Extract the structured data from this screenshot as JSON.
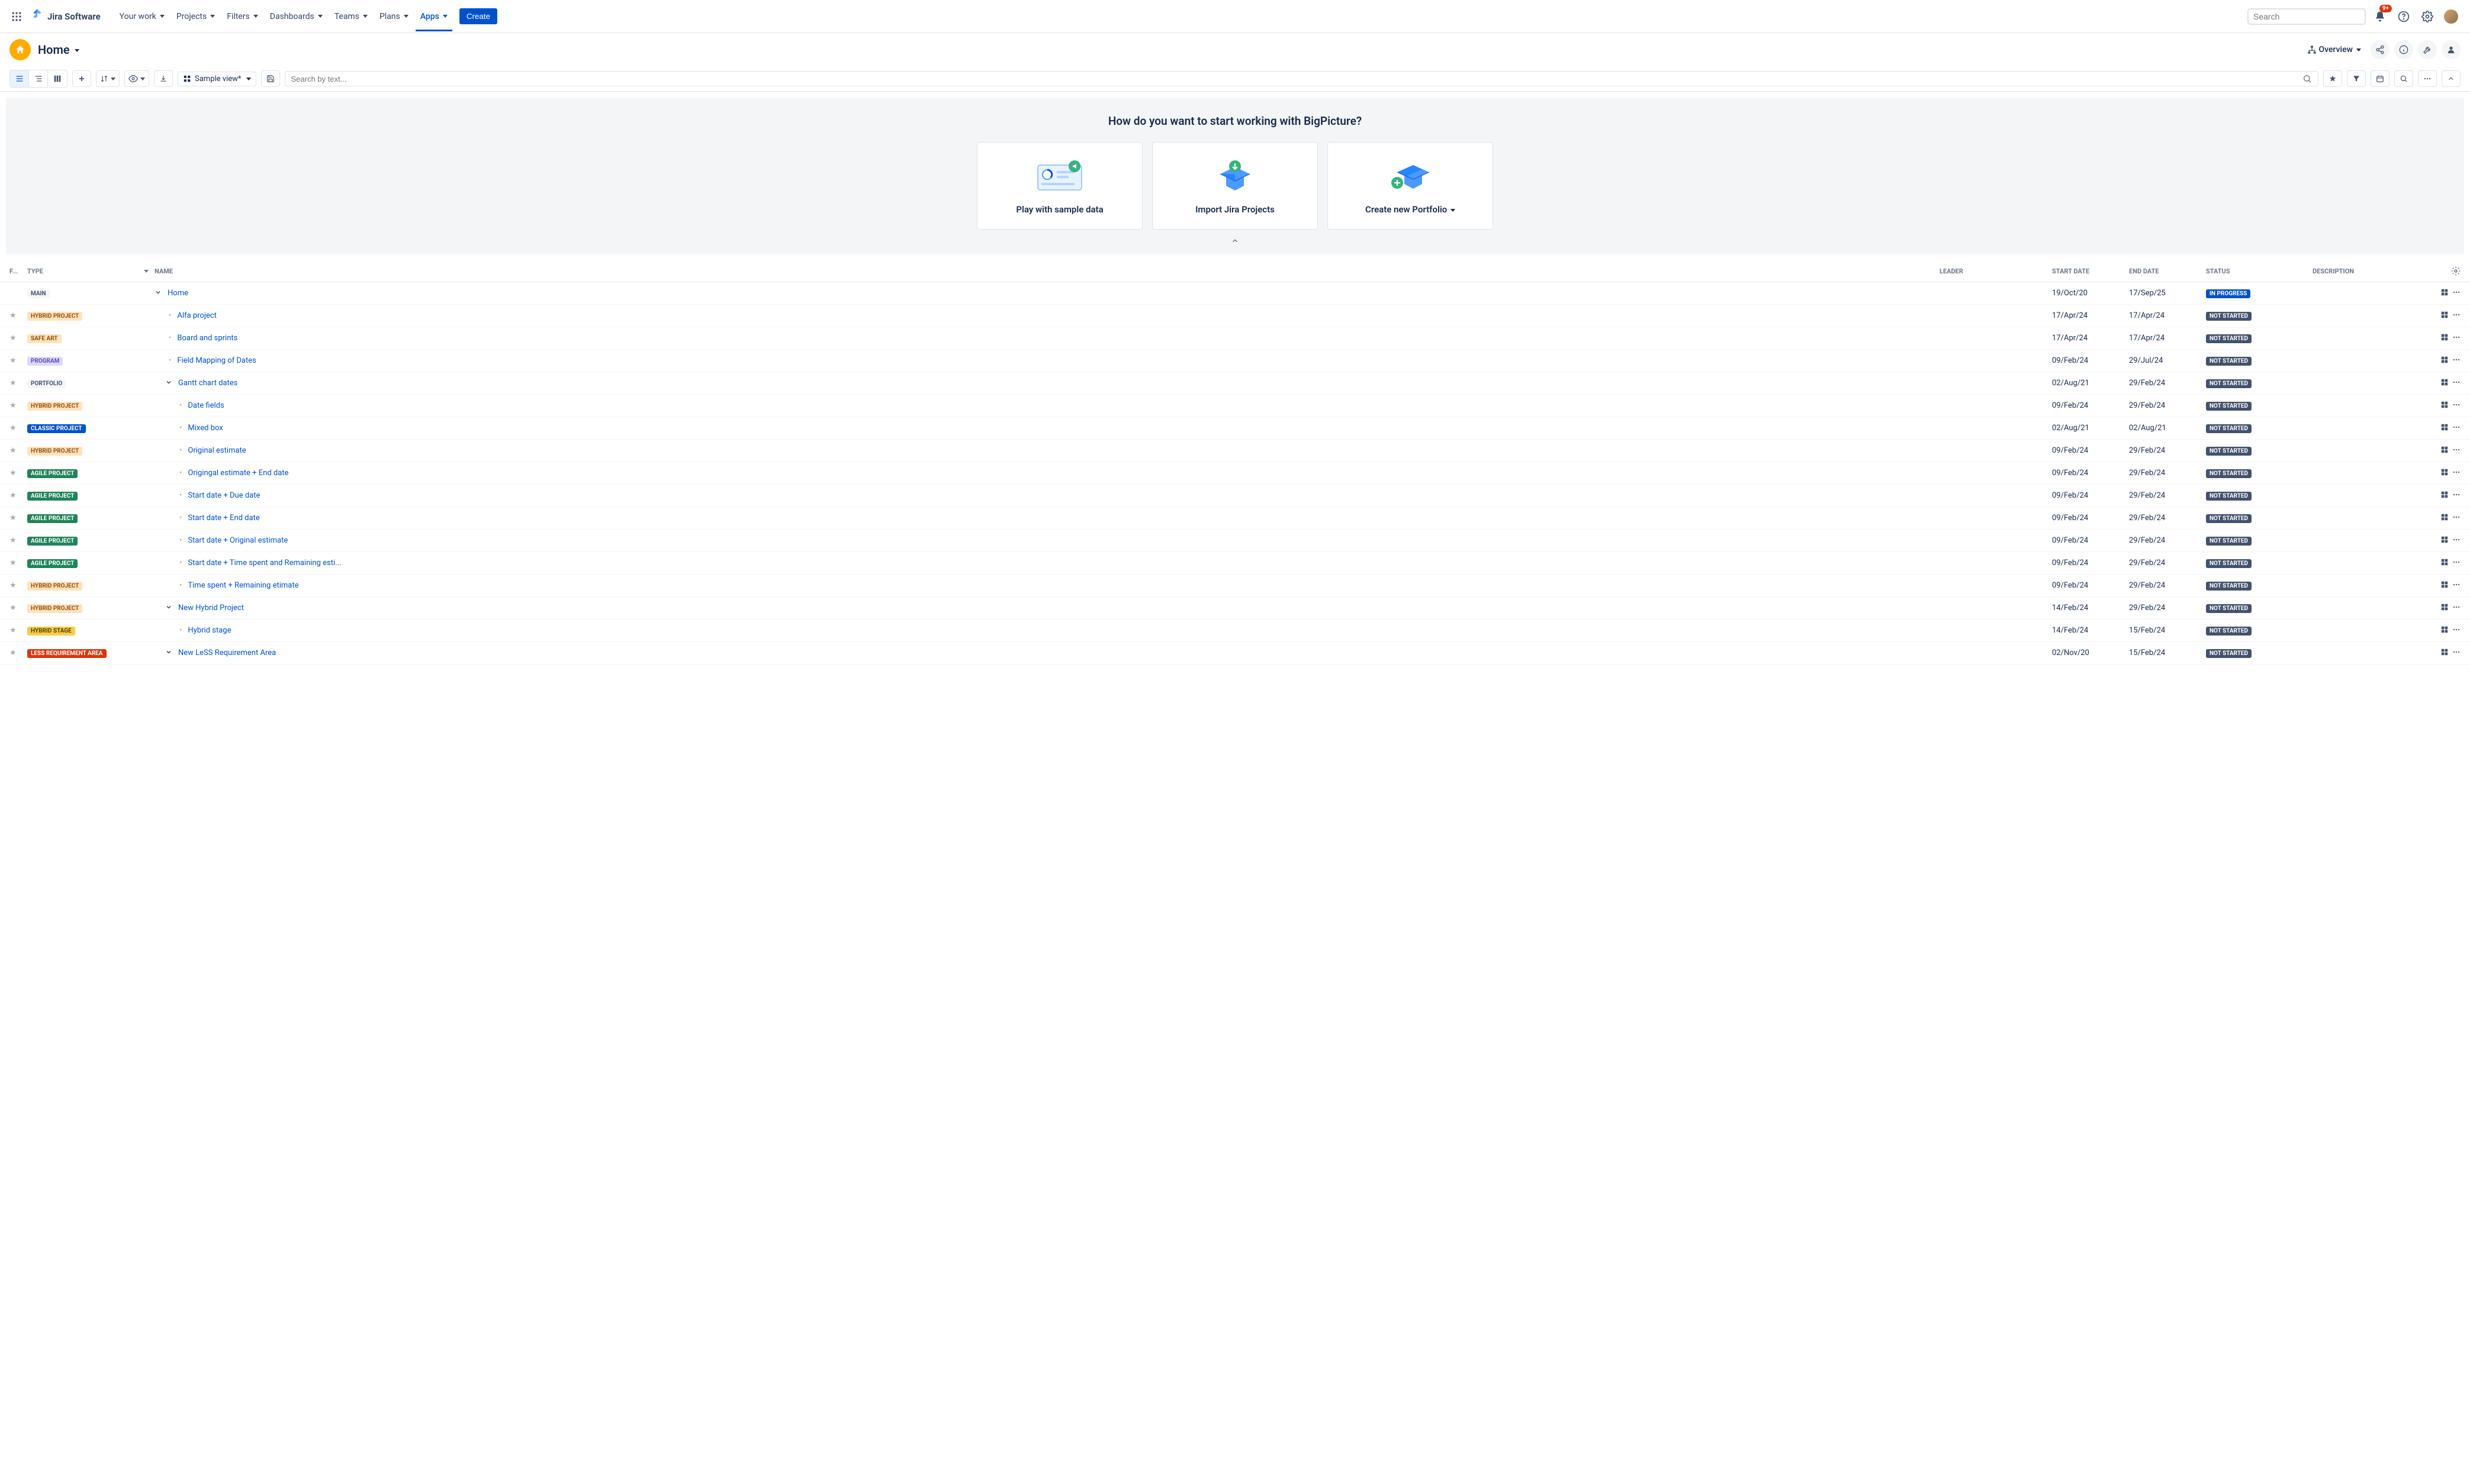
{
  "topnav": {
    "logo_text": "Jira Software",
    "items": [
      "Your work",
      "Projects",
      "Filters",
      "Dashboards",
      "Teams",
      "Plans",
      "Apps"
    ],
    "active_index": 6,
    "create_label": "Create",
    "search_placeholder": "Search",
    "notif_count": "9+"
  },
  "breadcrumb": {
    "title": "Home",
    "overview_label": "Overview"
  },
  "toolbar": {
    "view_label": "Sample view",
    "view_dirty": "*",
    "filter_placeholder": "Search by text..."
  },
  "banner": {
    "heading": "How do you want to start working with BigPicture?",
    "cards": [
      {
        "title": "Play with sample data"
      },
      {
        "title": "Import Jira Projects"
      },
      {
        "title": "Create new Portfolio"
      }
    ]
  },
  "table": {
    "headers": {
      "fav": "F...",
      "type": "TYPE",
      "name": "NAME",
      "leader": "LEADER",
      "start": "START DATE",
      "end": "END DATE",
      "status": "STATUS",
      "desc": "DESCRIPTION"
    },
    "type_colors": {
      "MAIN": {
        "bg": "#F4F5F7",
        "fg": "#42526E"
      },
      "HYBRID PROJECT": {
        "bg": "#FFE2BD",
        "fg": "#974F0C"
      },
      "SAFE ART": {
        "bg": "#FFE2BD",
        "fg": "#974F0C"
      },
      "PROGRAM": {
        "bg": "#DFD8FD",
        "fg": "#5E4DB2"
      },
      "PORTFOLIO": {
        "bg": "#F4F5F7",
        "fg": "#42526E"
      },
      "CLASSIC PROJECT": {
        "bg": "#0052CC",
        "fg": "#FFFFFF"
      },
      "AGILE PROJECT": {
        "bg": "#1F845A",
        "fg": "#FFFFFF"
      },
      "HYBRID STAGE": {
        "bg": "#F5CD47",
        "fg": "#533F04"
      },
      "LESS REQUIREMENT AREA": {
        "bg": "#DE350B",
        "fg": "#FFFFFF"
      }
    },
    "status_colors": {
      "IN PROGRESS": "#0052CC",
      "NOT STARTED": "#42526E"
    },
    "rows": [
      {
        "fav": false,
        "type": "MAIN",
        "indent": 0,
        "expand": "open",
        "name": "Home",
        "start": "19/Oct/20",
        "end": "17/Sep/25",
        "status": "IN PROGRESS"
      },
      {
        "fav": true,
        "type": "HYBRID PROJECT",
        "indent": 1,
        "expand": "leaf",
        "name": "Alfa project",
        "start": "17/Apr/24",
        "end": "17/Apr/24",
        "status": "NOT STARTED"
      },
      {
        "fav": true,
        "type": "SAFE ART",
        "indent": 1,
        "expand": "leaf",
        "name": "Board and sprints",
        "start": "17/Apr/24",
        "end": "17/Apr/24",
        "status": "NOT STARTED"
      },
      {
        "fav": true,
        "type": "PROGRAM",
        "indent": 1,
        "expand": "leaf",
        "name": "Field Mapping of Dates",
        "start": "09/Feb/24",
        "end": "29/Jul/24",
        "status": "NOT STARTED"
      },
      {
        "fav": true,
        "type": "PORTFOLIO",
        "indent": 1,
        "expand": "open",
        "name": "Gantt chart dates",
        "start": "02/Aug/21",
        "end": "29/Feb/24",
        "status": "NOT STARTED"
      },
      {
        "fav": true,
        "type": "HYBRID PROJECT",
        "indent": 2,
        "expand": "leaf",
        "name": "Date fields",
        "start": "09/Feb/24",
        "end": "29/Feb/24",
        "status": "NOT STARTED"
      },
      {
        "fav": true,
        "type": "CLASSIC PROJECT",
        "indent": 2,
        "expand": "leaf",
        "name": "Mixed box",
        "start": "02/Aug/21",
        "end": "02/Aug/21",
        "status": "NOT STARTED"
      },
      {
        "fav": true,
        "type": "HYBRID PROJECT",
        "indent": 2,
        "expand": "leaf",
        "name": "Original estimate",
        "start": "09/Feb/24",
        "end": "29/Feb/24",
        "status": "NOT STARTED"
      },
      {
        "fav": true,
        "type": "AGILE PROJECT",
        "indent": 2,
        "expand": "leaf",
        "name": "Origingal estimate + End date",
        "start": "09/Feb/24",
        "end": "29/Feb/24",
        "status": "NOT STARTED"
      },
      {
        "fav": true,
        "type": "AGILE PROJECT",
        "indent": 2,
        "expand": "leaf",
        "name": "Start date + Due date",
        "start": "09/Feb/24",
        "end": "29/Feb/24",
        "status": "NOT STARTED"
      },
      {
        "fav": true,
        "type": "AGILE PROJECT",
        "indent": 2,
        "expand": "leaf",
        "name": "Start date + End date",
        "start": "09/Feb/24",
        "end": "29/Feb/24",
        "status": "NOT STARTED"
      },
      {
        "fav": true,
        "type": "AGILE PROJECT",
        "indent": 2,
        "expand": "leaf",
        "name": "Start date + Original estimate",
        "start": "09/Feb/24",
        "end": "29/Feb/24",
        "status": "NOT STARTED"
      },
      {
        "fav": true,
        "type": "AGILE PROJECT",
        "indent": 2,
        "expand": "leaf",
        "name": "Start date + Time spent and Remaining esti...",
        "start": "09/Feb/24",
        "end": "29/Feb/24",
        "status": "NOT STARTED"
      },
      {
        "fav": true,
        "type": "HYBRID PROJECT",
        "indent": 2,
        "expand": "leaf",
        "name": "Time spent + Remaining etimate",
        "start": "09/Feb/24",
        "end": "29/Feb/24",
        "status": "NOT STARTED"
      },
      {
        "fav": true,
        "type": "HYBRID PROJECT",
        "indent": 1,
        "expand": "open",
        "name": "New Hybrid Project",
        "start": "14/Feb/24",
        "end": "29/Feb/24",
        "status": "NOT STARTED"
      },
      {
        "fav": true,
        "type": "HYBRID STAGE",
        "indent": 2,
        "expand": "leaf",
        "name": "Hybrid stage",
        "start": "14/Feb/24",
        "end": "15/Feb/24",
        "status": "NOT STARTED"
      },
      {
        "fav": true,
        "type": "LESS REQUIREMENT AREA",
        "indent": 1,
        "expand": "open",
        "name": "New LeSS Requirement Area",
        "start": "02/Nov/20",
        "end": "15/Feb/24",
        "status": "NOT STARTED"
      }
    ]
  }
}
